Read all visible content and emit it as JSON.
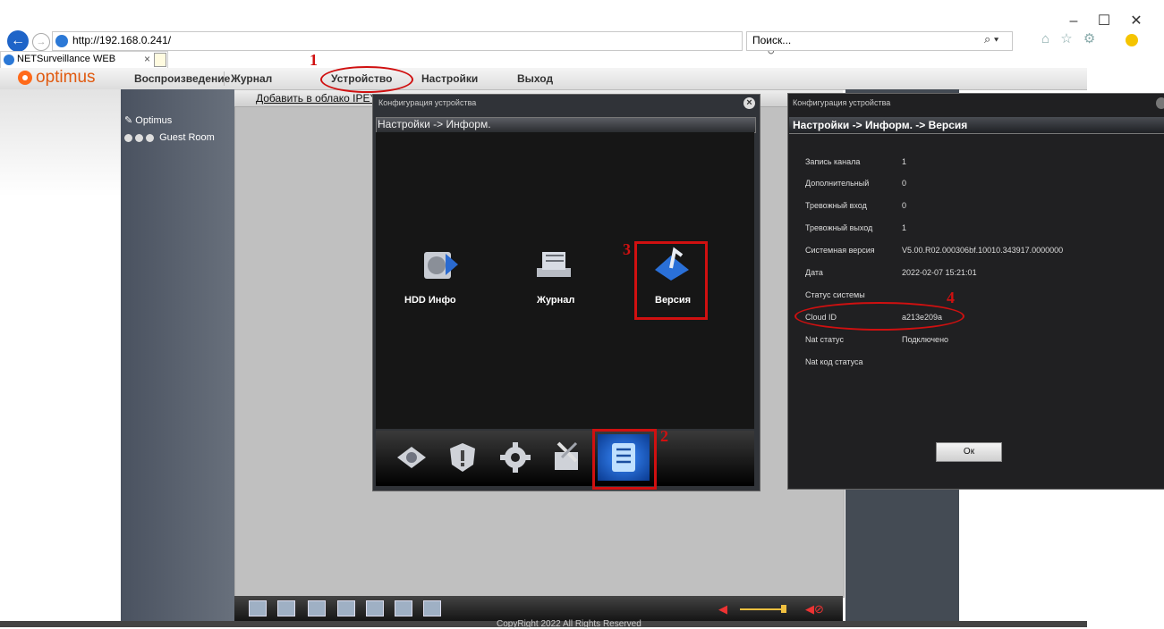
{
  "browser": {
    "address": "http://192.168.0.241/",
    "search_placeholder": "Поиск...",
    "tab_label": "NETSurveillance WEB",
    "window_minimize": "–",
    "window_maximize": "☐",
    "window_close": "✕",
    "address_tools": "▾ ↻",
    "search_icon": "⌕ ▾",
    "toolbar_icons": "⌂ ☆ ⚙"
  },
  "app": {
    "logo_text": "optimus",
    "menu": [
      "Воспроизведение",
      "Журнал",
      "Устройство",
      "Настройки",
      "Выход"
    ],
    "cloud_link": "Добавить в облако IPEYE",
    "copyright": "CopyRight 2022 All Rights Reserved"
  },
  "tree": {
    "root": "Optimus",
    "camera": "Guest Room"
  },
  "dialog_config": {
    "title": "Конфигурация устройства",
    "breadcrumb": "Настройки -> Информ.",
    "items": [
      "HDD Инфо",
      "Журнал",
      "Версия"
    ],
    "toolbar_icons": [
      "disk-icon",
      "shield-icon",
      "gear-icon",
      "tools-icon",
      "info-list-icon"
    ]
  },
  "dialog_version": {
    "title": "Конфигурация устройства",
    "breadcrumb": "Настройки -> Информ. -> Версия",
    "rows": [
      {
        "label": "Запись канала",
        "value": "1"
      },
      {
        "label": "Дополнительный",
        "value": "0"
      },
      {
        "label": "Тревожный вход",
        "value": "0"
      },
      {
        "label": "Тревожный выход",
        "value": "1"
      },
      {
        "label": "Системная версия",
        "value": "V5.00.R02.000306bf.10010.343917.0000000"
      },
      {
        "label": "Дата",
        "value": "2022-02-07 15:21:01"
      },
      {
        "label": "Статус системы",
        "value": ""
      },
      {
        "label": "Cloud ID",
        "value": "a213e209a"
      },
      {
        "label": "Nat статус",
        "value": "Подключено"
      },
      {
        "label": "Nat код статуса",
        "value": ""
      }
    ],
    "ok_label": "Ок"
  },
  "annotations": [
    "1",
    "2",
    "3",
    "4"
  ],
  "colors": {
    "annotation": "#d01010",
    "logo": "#ff6a1a"
  }
}
